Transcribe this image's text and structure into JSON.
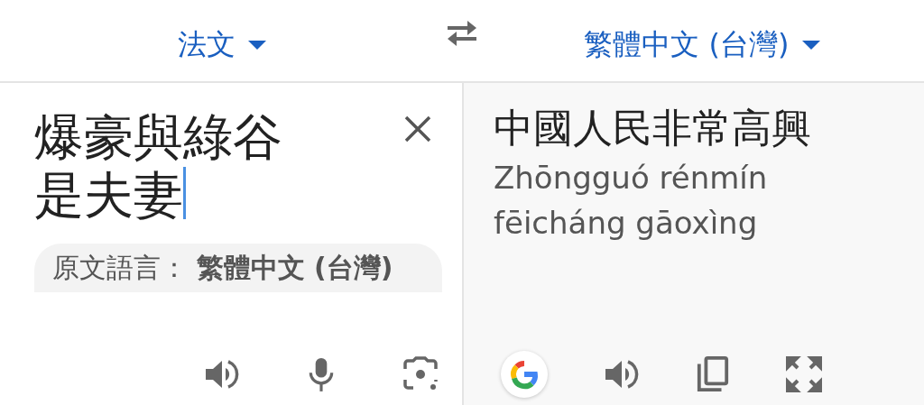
{
  "header": {
    "source_language": "法文",
    "target_language": "繁體中文 (台灣)"
  },
  "source": {
    "value": "爆豪與綠谷是夫妻",
    "detected": "原文語言： **繁體中文 (台灣)**"
  },
  "translation": {
    "text": "中國人民非常高興",
    "romanization": "Zhōngguó rénmín fēicháng gāoxìng"
  }
}
